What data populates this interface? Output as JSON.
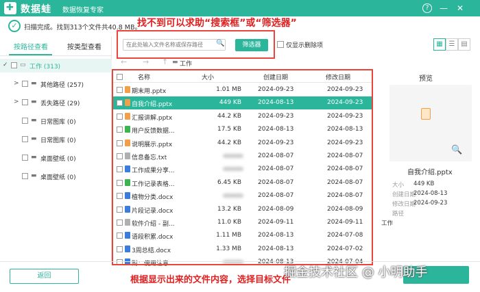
{
  "header": {
    "logo_glyph": "✚",
    "app_title": "数据蛙",
    "app_subtitle": "数据恢复专家",
    "help_icon": "?",
    "minimize_icon": "—",
    "close_icon": "✕"
  },
  "status": {
    "check_icon": "✓",
    "text": "扫描完成。找到313个文件共40.8 MB。"
  },
  "annotations": {
    "top": "找不到可以求助“搜索框”或“筛选器”",
    "bottom": "根据显示出来的文件内容，选择目标文件"
  },
  "search": {
    "placeholder": "在此处输入文件名称或保存路径",
    "search_icon": "🔍",
    "filter_label": "筛选器",
    "only_deleted_label": "仅显示删除项"
  },
  "view_buttons": {
    "grid_icon": "▦",
    "list_icon": "☰",
    "detail_icon": "▤"
  },
  "left_panel": {
    "tabs": [
      "按路径查看",
      "按类型查看"
    ],
    "tree": [
      {
        "label": "工作 (313)",
        "arrow": "✓",
        "icon": "▭"
      },
      {
        "label": "其他路径 (257)",
        "arrow": ">",
        "icon": "▬"
      },
      {
        "label": "丢失路径 (29)",
        "arrow": ">",
        "icon": "▬"
      },
      {
        "label": "日常图库 (0)",
        "arrow": "",
        "icon": "▬"
      },
      {
        "label": "日常图库 (0)",
        "arrow": "",
        "icon": "▬"
      },
      {
        "label": "桌面壁纸 (0)",
        "arrow": "",
        "icon": "▬"
      },
      {
        "label": "桌面壁纸 (0)",
        "arrow": "",
        "icon": "▬"
      }
    ]
  },
  "path_bar": {
    "back_icon": "←",
    "forward_icon": "→",
    "up_icon": "↑",
    "folder_icon": "▬",
    "path": "工作"
  },
  "table": {
    "columns": [
      "名称",
      "大小",
      "创建日期",
      "修改日期"
    ],
    "rows": [
      {
        "name": "期末用.pptx",
        "size": "1.01 MB",
        "created": "2024-09-23",
        "modified": "2024-09-23",
        "type": "pptx"
      },
      {
        "name": "自我介绍.pptx",
        "size": "449 KB",
        "created": "2024-08-13",
        "modified": "2024-09-23",
        "type": "pptx"
      },
      {
        "name": "汇报讲解.pptx",
        "size": "44.2 KB",
        "created": "2024-09-23",
        "modified": "2024-09-23",
        "type": "pptx"
      },
      {
        "name": "用户反馈数据...",
        "size": "17.5 KB",
        "created": "2024-08-13",
        "modified": "2024-08-13",
        "type": "xlsx"
      },
      {
        "name": "说明展示.pptx",
        "size": "44.2 KB",
        "created": "2024-09-23",
        "modified": "2024-09-23",
        "type": "pptx"
      },
      {
        "name": "信息备忘.txt",
        "size": "",
        "created": "2024-08-07",
        "modified": "2024-08-07",
        "type": "txt"
      },
      {
        "name": "工作成果分享...",
        "size": "",
        "created": "2024-08-07",
        "modified": "2024-08-07",
        "type": "docx"
      },
      {
        "name": "工作记录表格...",
        "size": "6.45 KB",
        "created": "2024-08-07",
        "modified": "2024-08-07",
        "type": "xlsx"
      },
      {
        "name": "植物分类.docx",
        "size": "",
        "created": "2024-08-07",
        "modified": "2024-08-07",
        "type": "docx"
      },
      {
        "name": "片段记录.docx",
        "size": "13.2 KB",
        "created": "2024-08-09",
        "modified": "2024-08-09",
        "type": "docx"
      },
      {
        "name": "软件介绍 - 副...",
        "size": "11.0 KB",
        "created": "2024-09-11",
        "modified": "2024-09-11",
        "type": "txt"
      },
      {
        "name": "语段积累.docx",
        "size": "1.11 MB",
        "created": "2024-08-13",
        "modified": "2024-07-08",
        "type": "docx"
      },
      {
        "name": "3周总结.docx",
        "size": "1.33 MB",
        "created": "2024-08-13",
        "modified": "2024-07-02",
        "type": "docx"
      },
      {
        "name": "附：使用注意...",
        "size": "",
        "created": "2024-08-13",
        "modified": "2024-07-04",
        "type": "docx"
      }
    ]
  },
  "preview": {
    "title": "预览",
    "zoom_icon": "🔍",
    "file_name": "自我介绍.pptx",
    "size_label": "大小",
    "size_value": "449 KB",
    "created_label": "创建日期",
    "created_value": "2024-08-13",
    "modified_label": "修改日期",
    "modified_value": "2024-09-23",
    "path_label": "路径",
    "location_label": "工作"
  },
  "footer": {
    "back_label": "返回",
    "watermark": "掘金技术社区 @ 小明助手"
  },
  "colors": {
    "accent": "#2bb59a",
    "annotation": "#e02020",
    "pptx": "#f0a04b",
    "xlsx": "#3fb34f",
    "docx": "#3b7ddd",
    "txt": "#b0b0b0"
  }
}
